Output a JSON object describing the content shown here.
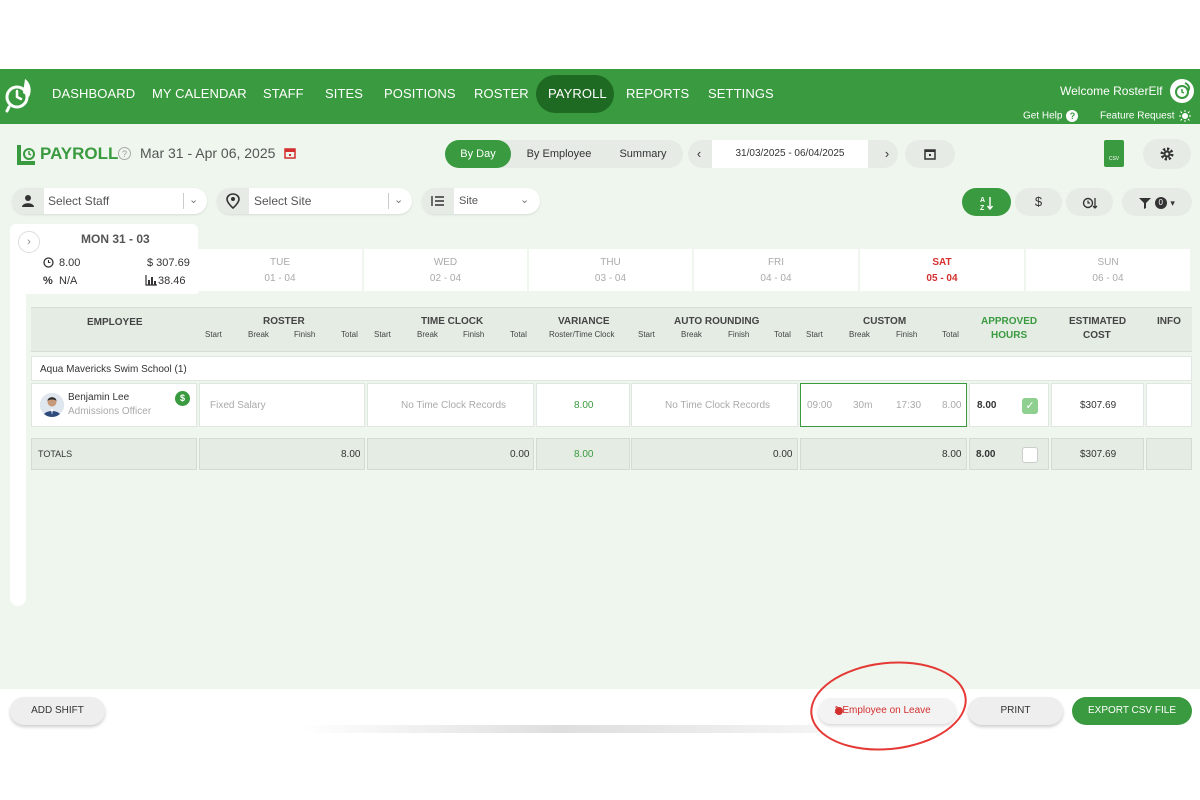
{
  "nav": {
    "items": [
      "DASHBOARD",
      "MY CALENDAR",
      "STAFF",
      "SITES",
      "POSITIONS",
      "ROSTER",
      "PAYROLL",
      "REPORTS",
      "SETTINGS"
    ],
    "active": "PAYROLL",
    "welcome": "Welcome RosterElf",
    "get_help": "Get Help",
    "feature_request": "Feature Request"
  },
  "header": {
    "title": "PAYROLL",
    "date_range": "Mar 31 - Apr 06, 2025",
    "view_tabs": [
      "By Day",
      "By Employee",
      "Summary"
    ],
    "active_tab": "By Day",
    "picker_range": "31/03/2025 - 06/04/2025",
    "csv_label": "CSV"
  },
  "filters": {
    "staff_placeholder": "Select Staff",
    "site_placeholder": "Select Site",
    "group_by": "Site",
    "filter_count": "0"
  },
  "days": {
    "active": {
      "label": "MON 31 - 03",
      "hours": "8.00",
      "cost": "$ 307.69",
      "percent": "N/A",
      "stat": "38.46"
    },
    "others": [
      {
        "name": "TUE",
        "date": "01 - 04"
      },
      {
        "name": "WED",
        "date": "02 - 04"
      },
      {
        "name": "THU",
        "date": "03 - 04"
      },
      {
        "name": "FRI",
        "date": "04 - 04"
      },
      {
        "name": "SAT",
        "date": "05 - 04"
      },
      {
        "name": "SUN",
        "date": "06 - 04"
      }
    ]
  },
  "table": {
    "headers": {
      "employee": "EMPLOYEE",
      "roster": "ROSTER",
      "time_clock": "TIME CLOCK",
      "variance": "VARIANCE",
      "variance_sub": "Roster/Time Clock",
      "auto_rounding": "AUTO ROUNDING",
      "custom": "CUSTOM",
      "approved": "APPROVED",
      "approved2": "HOURS",
      "estimated": "ESTIMATED",
      "estimated2": "COST",
      "info": "INFO"
    },
    "subheaders": {
      "start": "Start",
      "break": "Break",
      "finish": "Finish",
      "total": "Total"
    },
    "group": "Aqua Mavericks Swim School",
    "group_count": "(1)",
    "row": {
      "name": "Benjamin Lee",
      "role": "Admissions Officer",
      "roster": "Fixed Salary",
      "time_clock": "No Time Clock Records",
      "variance": "8.00",
      "auto_rounding": "No Time Clock Records",
      "custom_start": "09:00",
      "custom_break": "30m",
      "custom_finish": "17:30",
      "custom_total": "8.00",
      "approved": "8.00",
      "cost": "$307.69"
    },
    "totals": {
      "label": "TOTALS",
      "roster": "8.00",
      "time_clock": "0.00",
      "variance": "8.00",
      "auto_rounding": "0.00",
      "custom": "8.00",
      "approved": "8.00",
      "cost": "$307.69"
    }
  },
  "footer": {
    "add_shift": "ADD SHIFT",
    "leave": "1 Employee on Leave",
    "print": "PRINT",
    "export": "EXPORT CSV FILE"
  },
  "colors": {
    "brand": "#3a9a3f",
    "brand_dark": "#1f6a23",
    "alert": "#d32f2f"
  }
}
